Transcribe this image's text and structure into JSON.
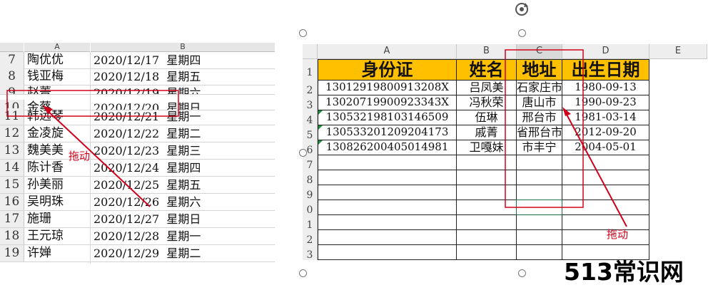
{
  "left": {
    "col_headers": [
      "A",
      "B"
    ],
    "rows": [
      {
        "num": "7",
        "name": "陶优优",
        "date": "2020/12/17",
        "weekday": "星期四"
      },
      {
        "num": "8",
        "name": "钱亚梅",
        "date": "2020/12/18",
        "weekday": "星期五"
      },
      {
        "num": "9",
        "name": "赵菁",
        "date": "2020/12/19",
        "weekday": "星期六"
      },
      {
        "num": "10",
        "name": "金蔡",
        "date": "2020/12/20",
        "weekday": "星期日"
      },
      {
        "num": "11",
        "name": "韩远琴",
        "date": "2020/12/21",
        "weekday": "星期一"
      },
      {
        "num": "12",
        "name": "金凌旋",
        "date": "2020/12/22",
        "weekday": "星期二"
      },
      {
        "num": "13",
        "name": "魏美美",
        "date": "2020/12/23",
        "weekday": "星期三"
      },
      {
        "num": "14",
        "name": "陈计香",
        "date": "2020/12/24",
        "weekday": "星期四"
      },
      {
        "num": "15",
        "name": "孙美丽",
        "date": "2020/12/25",
        "weekday": "星期五"
      },
      {
        "num": "16",
        "name": "吴明珠",
        "date": "2020/12/26",
        "weekday": "星期六"
      },
      {
        "num": "17",
        "name": "施珊",
        "date": "2020/12/27",
        "weekday": "星期日"
      },
      {
        "num": "18",
        "name": "王元琼",
        "date": "2020/12/28",
        "weekday": "星期一"
      },
      {
        "num": "19",
        "name": "许婵",
        "date": "2020/12/29",
        "weekday": "星期二"
      }
    ],
    "annotation": "拖动"
  },
  "right": {
    "col_headers": [
      "A",
      "B",
      "C",
      "D",
      "E"
    ],
    "row_numbers": [
      "1",
      "2",
      "3",
      "4",
      "5",
      "6",
      "7",
      "8",
      "9",
      "0",
      "1",
      "2",
      "3"
    ],
    "table_headers": [
      "身份证",
      "姓名",
      "地址",
      "出生日期"
    ],
    "rows": [
      {
        "id": "13012919800913208X",
        "name": "吕凤美",
        "addr": "石家庄市",
        "birth": "1980-09-13"
      },
      {
        "id": "13020719900923343X",
        "name": "冯秋荣",
        "addr": "唐山市",
        "birth": "1990-09-23"
      },
      {
        "id": "130532198103146509",
        "name": "伍琳",
        "addr": "邢台市",
        "birth": "1981-03-14"
      },
      {
        "id": "130533201209204173",
        "name": "戚菁",
        "addr": "省邢台市",
        "birth": "2012-09-20"
      },
      {
        "id": "130826200405014981",
        "name": "卫嘎妹",
        "addr": "市丰宁",
        "birth": "2004-05-01"
      }
    ],
    "annotation": "拖动"
  },
  "watermark": "513常识网",
  "colors": {
    "header_fill": "#ffc000",
    "annotation": "#d0021b",
    "grid": "#222222"
  }
}
